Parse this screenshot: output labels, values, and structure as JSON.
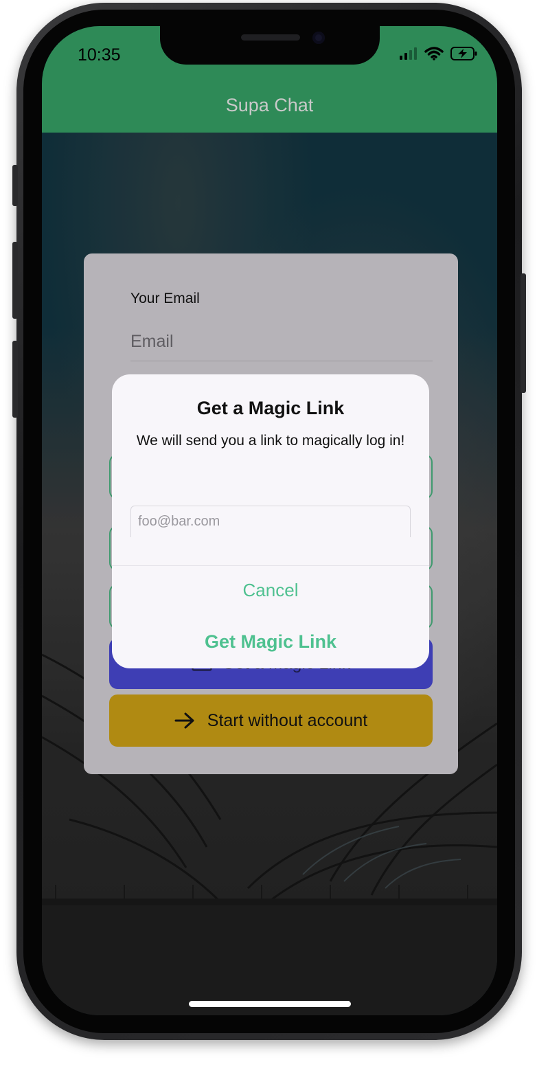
{
  "status_bar": {
    "time": "10:35"
  },
  "app_bar": {
    "title": "Supa Chat"
  },
  "login_card": {
    "email_label": "Your Email",
    "email_placeholder": "Email",
    "magic_button_label": "Get a Magic Link",
    "start_button_label": "Start without account"
  },
  "dialog": {
    "title": "Get a Magic Link",
    "message": "We will send you a link to magically log in!",
    "input_placeholder": "foo@bar.com",
    "cancel_label": "Cancel",
    "confirm_label": "Get Magic Link"
  },
  "colors": {
    "app_bar": "#2e8a57",
    "accent": "#4fc190",
    "magic_button": "#3e3eb4",
    "start_button": "#b08a12"
  },
  "icons": [
    "signal-icon",
    "wifi-icon",
    "battery-charging-icon",
    "mail-icon",
    "arrow-right-icon"
  ]
}
